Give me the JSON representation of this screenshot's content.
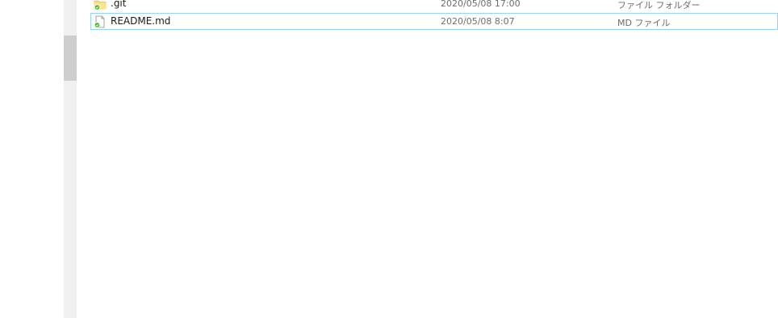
{
  "file_list": {
    "items": [
      {
        "name": ".git",
        "date_modified": "2020/05/08 17:00",
        "type": "ファイル フォルダー",
        "icon": "folder-git-icon",
        "selected": false
      },
      {
        "name": "README.md",
        "date_modified": "2020/05/08 8:07",
        "type": "MD ファイル",
        "icon": "file-git-icon",
        "selected": true
      }
    ]
  },
  "colors": {
    "selection_border": "#99d1ff",
    "scrollbar_track": "#f0f0f0",
    "scrollbar_thumb": "#cdcdcd",
    "status_badge": "#3fae2a",
    "secondary_text": "#6d6d6d"
  }
}
